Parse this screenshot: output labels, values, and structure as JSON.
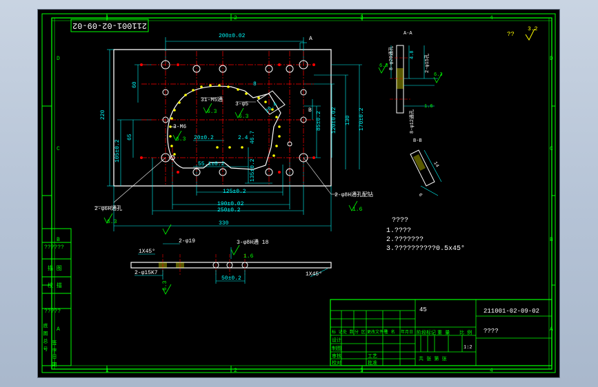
{
  "colors": {
    "frame": "#00ff00",
    "dimension": "#00ffff",
    "part": "#ffffff",
    "center": "#ff0000",
    "hole": "#ffff00",
    "annotation": "#ffff00",
    "background": "#000000"
  },
  "border": {
    "top_zones": [
      "1",
      "2",
      "3",
      "4"
    ],
    "bottom_zones": [
      "1",
      "2",
      "3",
      "4"
    ],
    "left_zones": [
      "D",
      "C",
      "B",
      "A"
    ],
    "right_zones": [
      "D",
      "C",
      "B",
      "A"
    ]
  },
  "drawing_code": "211001-02-09-02",
  "side_cells": [
    "??????",
    "描 图",
    "校 描",
    "?????",
    "底 图 总 号",
    "签 字",
    "日 期"
  ],
  "roughness_general": {
    "value": "3.2",
    "prefix": "??"
  },
  "dims_top": {
    "d200": "200±0.02",
    "d220": "220",
    "d60": "60",
    "d105": "105±0.2",
    "d65": "65",
    "d20": "20±0.2",
    "d24": "2.4",
    "d467": "46.7",
    "d551": "55.1±0.2",
    "d135": "135±0.2",
    "d125": "125±0.2",
    "d190": "190±0.02",
    "d250": "250±0.2",
    "d330": "330",
    "d85": "85±0.2",
    "d120": "120±0.02",
    "d130": "130",
    "d170": "170±0.2",
    "d8": "8",
    "d264": "26.4"
  },
  "callouts": {
    "m5": "31-M5通",
    "phi5": "3-φ5",
    "m6": "3-M6",
    "r63a": "6.3",
    "r63b": "6.3",
    "r63c": "6.3",
    "phi6_left": "2-φ6H通孔",
    "r63d": "6.3",
    "phi8_right": "2-φ8H通孔配钻",
    "r16": "1.6",
    "section_a": "A",
    "section_b": "B"
  },
  "side_view": {
    "phi19": "2-φ19",
    "chamfer_left": "1X45°",
    "phi8": "3-φ8H通 18",
    "r16": "1.6",
    "phi15": "2-φ15K7",
    "d50": "50±0.2",
    "chamfer_right": "1X45°",
    "r63": "6.3"
  },
  "section_aa": {
    "label": "A-A",
    "d8_phi20": "8-φ20通孔",
    "d48": "4.8",
    "d2_phi15": "2-φ15孔",
    "r63l": "6.3",
    "r63r": "6.3",
    "d8_phi12": "8-φ12通孔",
    "d16": "1.6"
  },
  "section_bb": {
    "label": "B-B",
    "d14": "14",
    "d6": "6"
  },
  "notes": {
    "title": "????",
    "items": [
      "1.????",
      "2.???????",
      "3.??????????0.5x45°"
    ]
  },
  "title_block": {
    "material": "45",
    "code": "211001-02-09-02",
    "name": "????",
    "scale": "1:2",
    "row_labels": [
      "标 记",
      "处 数",
      "分 区",
      "更改文件号",
      "签 名",
      "年月日"
    ],
    "cells": [
      "设计",
      "制图",
      "审核",
      "校对",
      "工艺",
      "批准"
    ],
    "heads": [
      "阶段标记",
      "重 量",
      "比 例"
    ],
    "share": "共 张 第 张"
  }
}
